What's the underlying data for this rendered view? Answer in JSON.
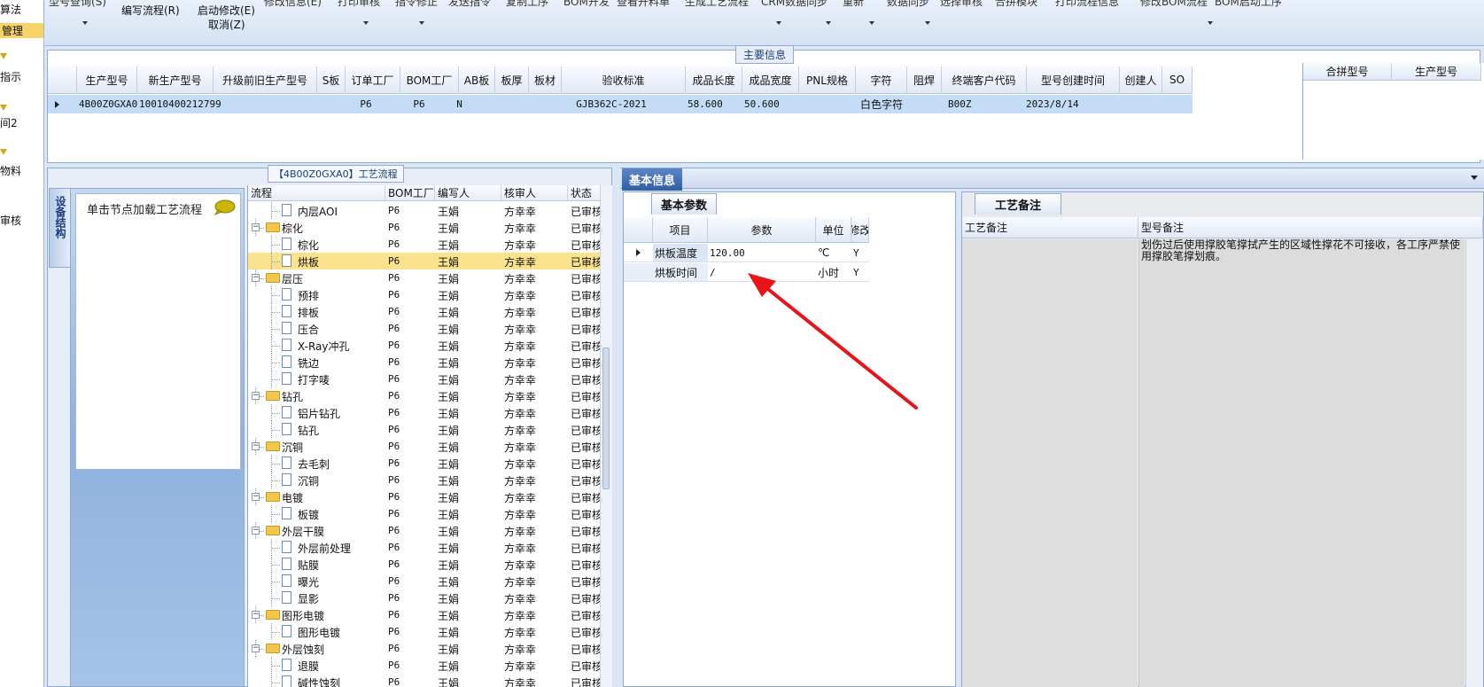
{
  "left_strip": {
    "items": [
      "算法",
      "管理",
      "指示",
      "间2",
      "物料",
      "审核"
    ]
  },
  "menu": {
    "cut_labels": [
      "型号查询(S)",
      "修改信息(E)",
      "打印审核",
      "指令修正",
      "发送指令",
      "复制工序",
      "BOM开发",
      "查看开料单",
      "生成工艺流程",
      "CRM数据同步",
      "重新",
      "数据同步",
      "选择审核",
      "合拼模块",
      "打印流程信息",
      "修改BOM流程",
      "BOM启动工序"
    ],
    "items": [
      {
        "label": "编写流程(R)"
      },
      {
        "label": "启动修改(E)"
      },
      {
        "label": "取消(Z)"
      }
    ]
  },
  "main_info": {
    "title": "主要信息",
    "columns": [
      "生产型号",
      "新生产型号",
      "升级前旧生产型号",
      "S板",
      "订单工厂",
      "BOM工厂",
      "AB板",
      "板厚",
      "板材",
      "验收标准",
      "成品长度",
      "成品宽度",
      "PNL规格",
      "字符",
      "阻焊",
      "终端客户代码",
      "型号创建时间",
      "创建人",
      "SO"
    ],
    "row": {
      "prod_model": "4B00Z0GXA0",
      "new_model": "10010400212799",
      "old_model": "",
      "s_board": "",
      "order_factory": "P6",
      "bom_factory": "P6",
      "ab_board": "N",
      "thickness": "",
      "material": "",
      "standard": "GJB362C-2021",
      "length": "58.600",
      "width": "50.600",
      "pnl": "",
      "char": "白色字符",
      "mask": "",
      "customer": "B00Z",
      "created": "2023/8/14",
      "creator": "",
      "so": ""
    },
    "merge_columns": [
      "合拼型号",
      "生产型号"
    ]
  },
  "process": {
    "title": "【4B00Z0GXA0】工艺流程",
    "side_tab": "设备结构",
    "node_hint": "单击节点加载工艺流程",
    "columns": [
      "流程",
      "BOM工厂",
      "编写人",
      "核审人",
      "状态"
    ],
    "rows": [
      {
        "name": "内层AOI",
        "type": "leaf",
        "bom": "P6",
        "writer": "王娟",
        "reviewer": "方幸幸",
        "status": "已审核"
      },
      {
        "name": "棕化",
        "type": "folder",
        "bom": "P6",
        "writer": "王娟",
        "reviewer": "方幸幸",
        "status": "已审核"
      },
      {
        "name": "棕化",
        "type": "leaf",
        "bom": "P6",
        "writer": "王娟",
        "reviewer": "方幸幸",
        "status": "已审核"
      },
      {
        "name": "烘板",
        "type": "leaf",
        "bom": "P6",
        "writer": "王娟",
        "reviewer": "方幸幸",
        "status": "已审核",
        "selected": true
      },
      {
        "name": "层压",
        "type": "folder",
        "bom": "P6",
        "writer": "王娟",
        "reviewer": "方幸幸",
        "status": "已审核"
      },
      {
        "name": "预排",
        "type": "leaf",
        "bom": "P6",
        "writer": "王娟",
        "reviewer": "方幸幸",
        "status": "已审核"
      },
      {
        "name": "排板",
        "type": "leaf",
        "bom": "P6",
        "writer": "王娟",
        "reviewer": "方幸幸",
        "status": "已审核"
      },
      {
        "name": "压合",
        "type": "leaf",
        "bom": "P6",
        "writer": "王娟",
        "reviewer": "方幸幸",
        "status": "已审核"
      },
      {
        "name": "X-Ray冲孔",
        "type": "leaf",
        "bom": "P6",
        "writer": "王娟",
        "reviewer": "方幸幸",
        "status": "已审核"
      },
      {
        "name": "铣边",
        "type": "leaf",
        "bom": "P6",
        "writer": "王娟",
        "reviewer": "方幸幸",
        "status": "已审核"
      },
      {
        "name": "打字唛",
        "type": "leaf",
        "bom": "P6",
        "writer": "王娟",
        "reviewer": "方幸幸",
        "status": "已审核"
      },
      {
        "name": "钻孔",
        "type": "folder",
        "bom": "P6",
        "writer": "王娟",
        "reviewer": "方幸幸",
        "status": "已审核"
      },
      {
        "name": "铝片钻孔",
        "type": "leaf",
        "bom": "P6",
        "writer": "王娟",
        "reviewer": "方幸幸",
        "status": "已审核"
      },
      {
        "name": "钻孔",
        "type": "leaf",
        "bom": "P6",
        "writer": "王娟",
        "reviewer": "方幸幸",
        "status": "已审核"
      },
      {
        "name": "沉铜",
        "type": "folder",
        "bom": "P6",
        "writer": "王娟",
        "reviewer": "方幸幸",
        "status": "已审核"
      },
      {
        "name": "去毛刺",
        "type": "leaf",
        "bom": "P6",
        "writer": "王娟",
        "reviewer": "方幸幸",
        "status": "已审核"
      },
      {
        "name": "沉铜",
        "type": "leaf",
        "bom": "P6",
        "writer": "王娟",
        "reviewer": "方幸幸",
        "status": "已审核"
      },
      {
        "name": "电镀",
        "type": "folder",
        "bom": "P6",
        "writer": "王娟",
        "reviewer": "方幸幸",
        "status": "已审核"
      },
      {
        "name": "板镀",
        "type": "leaf",
        "bom": "P6",
        "writer": "王娟",
        "reviewer": "方幸幸",
        "status": "已审核"
      },
      {
        "name": "外层干膜",
        "type": "folder",
        "bom": "P6",
        "writer": "王娟",
        "reviewer": "方幸幸",
        "status": "已审核"
      },
      {
        "name": "外层前处理",
        "type": "leaf",
        "bom": "P6",
        "writer": "王娟",
        "reviewer": "方幸幸",
        "status": "已审核"
      },
      {
        "name": "贴膜",
        "type": "leaf",
        "bom": "P6",
        "writer": "王娟",
        "reviewer": "方幸幸",
        "status": "已审核"
      },
      {
        "name": "曝光",
        "type": "leaf",
        "bom": "P6",
        "writer": "王娟",
        "reviewer": "方幸幸",
        "status": "已审核"
      },
      {
        "name": "显影",
        "type": "leaf",
        "bom": "P6",
        "writer": "王娟",
        "reviewer": "方幸幸",
        "status": "已审核"
      },
      {
        "name": "图形电镀",
        "type": "folder",
        "bom": "P6",
        "writer": "王娟",
        "reviewer": "方幸幸",
        "status": "已审核"
      },
      {
        "name": "图形电镀",
        "type": "leaf",
        "bom": "P6",
        "writer": "王娟",
        "reviewer": "方幸幸",
        "status": "已审核"
      },
      {
        "name": "外层蚀刻",
        "type": "folder",
        "bom": "P6",
        "writer": "王娟",
        "reviewer": "方幸幸",
        "status": "已审核"
      },
      {
        "name": "退膜",
        "type": "leaf",
        "bom": "P6",
        "writer": "王娟",
        "reviewer": "方幸幸",
        "status": "已审核"
      },
      {
        "name": "碱性蚀刻",
        "type": "leaf",
        "bom": "P6",
        "writer": "王娟",
        "reviewer": "方幸幸",
        "status": "已审核"
      }
    ]
  },
  "basic_info": {
    "tab": "基本信息",
    "param_tab": "基本参数",
    "param_columns": [
      "项目",
      "参数",
      "单位",
      "修改"
    ],
    "params": [
      {
        "item": "烘板温度",
        "value": "120.00",
        "unit": "℃",
        "flag": "Y"
      },
      {
        "item": "烘板时间",
        "value": "/",
        "unit": "小时",
        "flag": "Y"
      }
    ],
    "note_tab": "工艺备注",
    "note_columns": [
      "工艺备注",
      "型号备注"
    ],
    "model_note": "划伤过后使用撑胶笔撑拭产生的区域性撑花不可接收，各工序严禁使用撑胶笔撑划痕。"
  },
  "colors": {
    "selection": "#c4dcf5",
    "tree_selection": "#fbe38e",
    "tab_active": "#2f5ea8",
    "annotation": "#e8141a"
  }
}
